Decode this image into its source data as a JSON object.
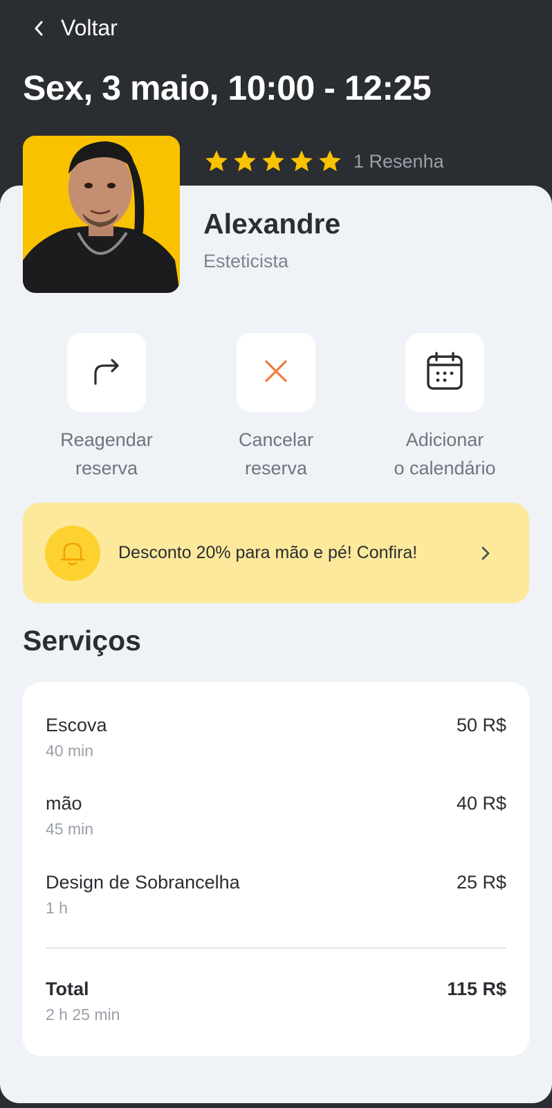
{
  "header": {
    "back_label": "Voltar",
    "title": "Sex, 3 maio, 10:00 - 12:25"
  },
  "professional": {
    "name": "Alexandre",
    "role": "Esteticista",
    "rating_stars": 5,
    "reviews_label": "1 Resenha"
  },
  "actions": [
    {
      "label": "Reagendar\nreserva",
      "icon": "redo-arrow-icon"
    },
    {
      "label": "Cancelar\nreserva",
      "icon": "close-icon"
    },
    {
      "label": "Adicionar\no calendário",
      "icon": "calendar-icon"
    }
  ],
  "promo": {
    "text": "Desconto 20% para mão e pé! Confira!",
    "icon": "bell-icon"
  },
  "services_section": {
    "title": "Serviços",
    "items": [
      {
        "name": "Escova",
        "duration": "40 min",
        "price": "50 R$"
      },
      {
        "name": "mão",
        "duration": "45 min",
        "price": "40 R$"
      },
      {
        "name": "Design de Sobrancelha",
        "duration": "1 h",
        "price": "25 R$"
      }
    ],
    "total": {
      "label": "Total",
      "duration": "2 h 25 min",
      "price": "115 R$"
    }
  },
  "colors": {
    "header_bg": "#2a2d31",
    "sheet_bg": "#eff2f7",
    "star": "#f8c200",
    "avatar_bg": "#f8c200",
    "promo_bg": "#fde99c",
    "promo_icon_bg": "#fdd230",
    "cancel_accent": "#f07a3a"
  }
}
